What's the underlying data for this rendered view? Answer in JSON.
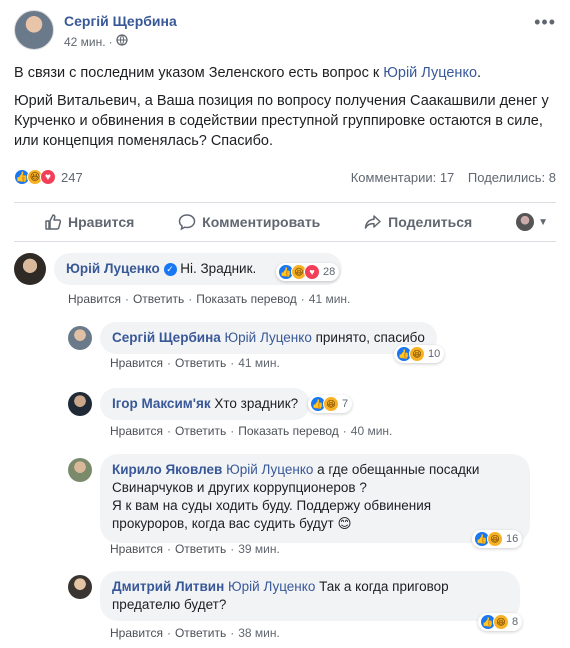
{
  "post": {
    "author": "Сергій Щербина",
    "time": "42 мин.",
    "privacy_icon": "globe-icon",
    "paragraph1_prefix": "В связи с последним указом Зеленского есть вопрос к ",
    "paragraph1_link": "Юрій Луценко",
    "paragraph1_suffix": ".",
    "paragraph2": "Юрий Витальевич, а Ваша позиция по вопросу получения Саакашвили денег у Курченко и обвинения в содействии преступной группировке остаются в силе, или концепция поменялась? Спасибо.",
    "reaction_count": "247",
    "comments_label": "Комментарии: 17",
    "shares_label": "Поделились: 8"
  },
  "actions": {
    "like": "Нравится",
    "comment": "Комментировать",
    "share": "Поделиться"
  },
  "comments": [
    {
      "name": "Юрій Луценко",
      "text": "Ні. Зрадник.",
      "reactions": "28",
      "like": "Нравится",
      "reply": "Ответить",
      "translate": "Показать перевод",
      "time": "41 мин."
    },
    {
      "name": "Сергій Щербина",
      "mention": "Юрій Луценко",
      "text": " принято, спасибо",
      "reactions": "10",
      "like": "Нравится",
      "reply": "Ответить",
      "time": "41 мин."
    },
    {
      "name": "Ігор Максим'як",
      "text": "Хто зрадник?",
      "reactions": "7",
      "like": "Нравится",
      "reply": "Ответить",
      "translate": "Показать перевод",
      "time": "40 мин."
    },
    {
      "name": "Кирило Яковлев",
      "mention": "Юрій Луценко",
      "text_line1": " а где обещанные посадки",
      "text_line2": "Свинарчуков и других коррупционеров ?",
      "text_line3": "Я к вам на суды ходить буду. Поддержу обвинения",
      "text_line4": "прокуроров, когда вас судить будут",
      "emoji": "😊",
      "reactions": "16",
      "like": "Нравится",
      "reply": "Ответить",
      "time": "39 мин."
    },
    {
      "name": "Дмитрий Литвин",
      "mention": "Юрій Луценко",
      "text_line1": " Так а когда приговор",
      "text_line2": "предателю будет?",
      "reactions": "8",
      "like": "Нравится",
      "reply": "Ответить",
      "time": "38 мин."
    }
  ]
}
